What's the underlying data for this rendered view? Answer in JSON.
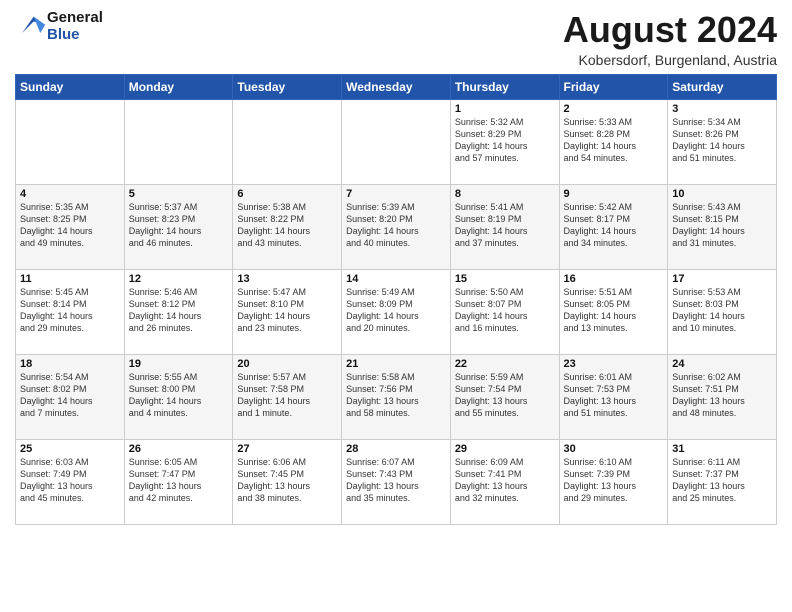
{
  "header": {
    "logo_line1": "General",
    "logo_line2": "Blue",
    "month": "August 2024",
    "location": "Kobersdorf, Burgenland, Austria"
  },
  "weekdays": [
    "Sunday",
    "Monday",
    "Tuesday",
    "Wednesday",
    "Thursday",
    "Friday",
    "Saturday"
  ],
  "weeks": [
    [
      {
        "day": "",
        "info": ""
      },
      {
        "day": "",
        "info": ""
      },
      {
        "day": "",
        "info": ""
      },
      {
        "day": "",
        "info": ""
      },
      {
        "day": "1",
        "info": "Sunrise: 5:32 AM\nSunset: 8:29 PM\nDaylight: 14 hours\nand 57 minutes."
      },
      {
        "day": "2",
        "info": "Sunrise: 5:33 AM\nSunset: 8:28 PM\nDaylight: 14 hours\nand 54 minutes."
      },
      {
        "day": "3",
        "info": "Sunrise: 5:34 AM\nSunset: 8:26 PM\nDaylight: 14 hours\nand 51 minutes."
      }
    ],
    [
      {
        "day": "4",
        "info": "Sunrise: 5:35 AM\nSunset: 8:25 PM\nDaylight: 14 hours\nand 49 minutes."
      },
      {
        "day": "5",
        "info": "Sunrise: 5:37 AM\nSunset: 8:23 PM\nDaylight: 14 hours\nand 46 minutes."
      },
      {
        "day": "6",
        "info": "Sunrise: 5:38 AM\nSunset: 8:22 PM\nDaylight: 14 hours\nand 43 minutes."
      },
      {
        "day": "7",
        "info": "Sunrise: 5:39 AM\nSunset: 8:20 PM\nDaylight: 14 hours\nand 40 minutes."
      },
      {
        "day": "8",
        "info": "Sunrise: 5:41 AM\nSunset: 8:19 PM\nDaylight: 14 hours\nand 37 minutes."
      },
      {
        "day": "9",
        "info": "Sunrise: 5:42 AM\nSunset: 8:17 PM\nDaylight: 14 hours\nand 34 minutes."
      },
      {
        "day": "10",
        "info": "Sunrise: 5:43 AM\nSunset: 8:15 PM\nDaylight: 14 hours\nand 31 minutes."
      }
    ],
    [
      {
        "day": "11",
        "info": "Sunrise: 5:45 AM\nSunset: 8:14 PM\nDaylight: 14 hours\nand 29 minutes."
      },
      {
        "day": "12",
        "info": "Sunrise: 5:46 AM\nSunset: 8:12 PM\nDaylight: 14 hours\nand 26 minutes."
      },
      {
        "day": "13",
        "info": "Sunrise: 5:47 AM\nSunset: 8:10 PM\nDaylight: 14 hours\nand 23 minutes."
      },
      {
        "day": "14",
        "info": "Sunrise: 5:49 AM\nSunset: 8:09 PM\nDaylight: 14 hours\nand 20 minutes."
      },
      {
        "day": "15",
        "info": "Sunrise: 5:50 AM\nSunset: 8:07 PM\nDaylight: 14 hours\nand 16 minutes."
      },
      {
        "day": "16",
        "info": "Sunrise: 5:51 AM\nSunset: 8:05 PM\nDaylight: 14 hours\nand 13 minutes."
      },
      {
        "day": "17",
        "info": "Sunrise: 5:53 AM\nSunset: 8:03 PM\nDaylight: 14 hours\nand 10 minutes."
      }
    ],
    [
      {
        "day": "18",
        "info": "Sunrise: 5:54 AM\nSunset: 8:02 PM\nDaylight: 14 hours\nand 7 minutes."
      },
      {
        "day": "19",
        "info": "Sunrise: 5:55 AM\nSunset: 8:00 PM\nDaylight: 14 hours\nand 4 minutes."
      },
      {
        "day": "20",
        "info": "Sunrise: 5:57 AM\nSunset: 7:58 PM\nDaylight: 14 hours\nand 1 minute."
      },
      {
        "day": "21",
        "info": "Sunrise: 5:58 AM\nSunset: 7:56 PM\nDaylight: 13 hours\nand 58 minutes."
      },
      {
        "day": "22",
        "info": "Sunrise: 5:59 AM\nSunset: 7:54 PM\nDaylight: 13 hours\nand 55 minutes."
      },
      {
        "day": "23",
        "info": "Sunrise: 6:01 AM\nSunset: 7:53 PM\nDaylight: 13 hours\nand 51 minutes."
      },
      {
        "day": "24",
        "info": "Sunrise: 6:02 AM\nSunset: 7:51 PM\nDaylight: 13 hours\nand 48 minutes."
      }
    ],
    [
      {
        "day": "25",
        "info": "Sunrise: 6:03 AM\nSunset: 7:49 PM\nDaylight: 13 hours\nand 45 minutes."
      },
      {
        "day": "26",
        "info": "Sunrise: 6:05 AM\nSunset: 7:47 PM\nDaylight: 13 hours\nand 42 minutes."
      },
      {
        "day": "27",
        "info": "Sunrise: 6:06 AM\nSunset: 7:45 PM\nDaylight: 13 hours\nand 38 minutes."
      },
      {
        "day": "28",
        "info": "Sunrise: 6:07 AM\nSunset: 7:43 PM\nDaylight: 13 hours\nand 35 minutes."
      },
      {
        "day": "29",
        "info": "Sunrise: 6:09 AM\nSunset: 7:41 PM\nDaylight: 13 hours\nand 32 minutes."
      },
      {
        "day": "30",
        "info": "Sunrise: 6:10 AM\nSunset: 7:39 PM\nDaylight: 13 hours\nand 29 minutes."
      },
      {
        "day": "31",
        "info": "Sunrise: 6:11 AM\nSunset: 7:37 PM\nDaylight: 13 hours\nand 25 minutes."
      }
    ]
  ]
}
